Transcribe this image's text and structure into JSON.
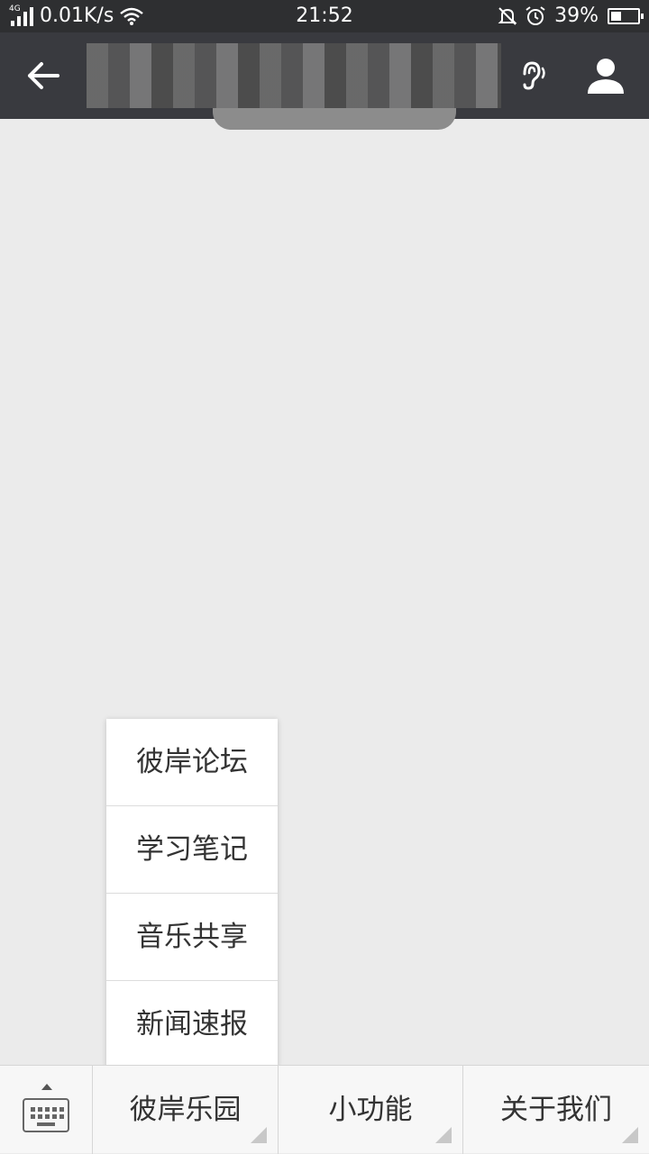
{
  "status_bar": {
    "network": "4G",
    "speed": "0.01K/s",
    "time": "21:52",
    "battery_percent": "39%",
    "battery_level": 0.39,
    "icons": [
      "signal-icon",
      "wifi-icon",
      "silent-bell-icon",
      "alarm-icon",
      "battery-icon"
    ]
  },
  "title_bar": {
    "background": "#393a3f",
    "icons": [
      "back-arrow-icon",
      "ear-icon",
      "profile-icon"
    ]
  },
  "popup_menu": {
    "items": [
      {
        "label": "彼岸论坛"
      },
      {
        "label": "学习笔记"
      },
      {
        "label": "音乐共享"
      },
      {
        "label": "新闻速报"
      }
    ]
  },
  "bottom_menu": {
    "keyboard_icon": "keyboard-toggle-icon",
    "items": [
      {
        "label": "彼岸乐园"
      },
      {
        "label": "小功能"
      },
      {
        "label": "关于我们"
      }
    ]
  }
}
